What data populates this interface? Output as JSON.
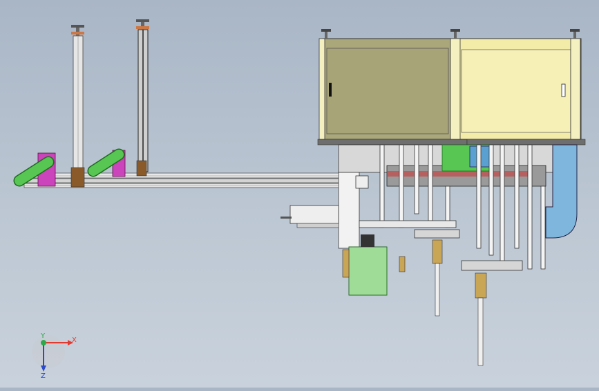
{
  "viewport": {
    "background_top": "#a9b6c6",
    "background_bottom": "#c9d2dc"
  },
  "triad": {
    "x_label": "X",
    "y_label": "Y",
    "z_label": "Z",
    "x_color": "#e23a2f",
    "y_color": "#2ea84a",
    "z_color": "#2b49c9"
  },
  "colors": {
    "cabinet_left": "#aaa77a",
    "cabinet_right": "#f3eca8",
    "guard_blue": "#7fb6dd",
    "green_part": "#57c653",
    "magenta_bracket": "#cc44bb",
    "light_green_block": "#9fdc98",
    "brass": "#c9a556"
  }
}
